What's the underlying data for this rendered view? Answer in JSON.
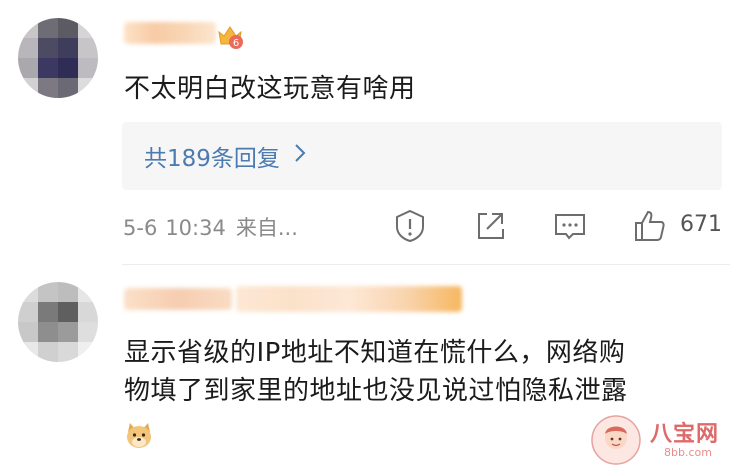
{
  "comments": [
    {
      "text": "不太明白改这玩意有啥用",
      "replies_label": "共189条回复",
      "date": "5-6",
      "time": "10:34",
      "source": "来自...",
      "likes": "671",
      "badge_level": "6"
    },
    {
      "line1": "显示省级的IP地址不知道在慌什么，网络购",
      "line2": "物填了到家里的地址也没见说过怕隐私泄露"
    }
  ],
  "icons": {
    "report": "report-icon",
    "forward": "forward-icon",
    "comment": "comment-icon",
    "like": "thumbs-up-icon",
    "chevron": "chevron-right-icon",
    "emoji": "doge-emoji-icon"
  },
  "watermark": {
    "name": "八宝网",
    "url": "8bb.com"
  },
  "colors": {
    "link": "#4b7bb0",
    "meta": "#8a8a8a",
    "reply_bg": "#f6f6f6",
    "watermark": "#e0696a"
  }
}
